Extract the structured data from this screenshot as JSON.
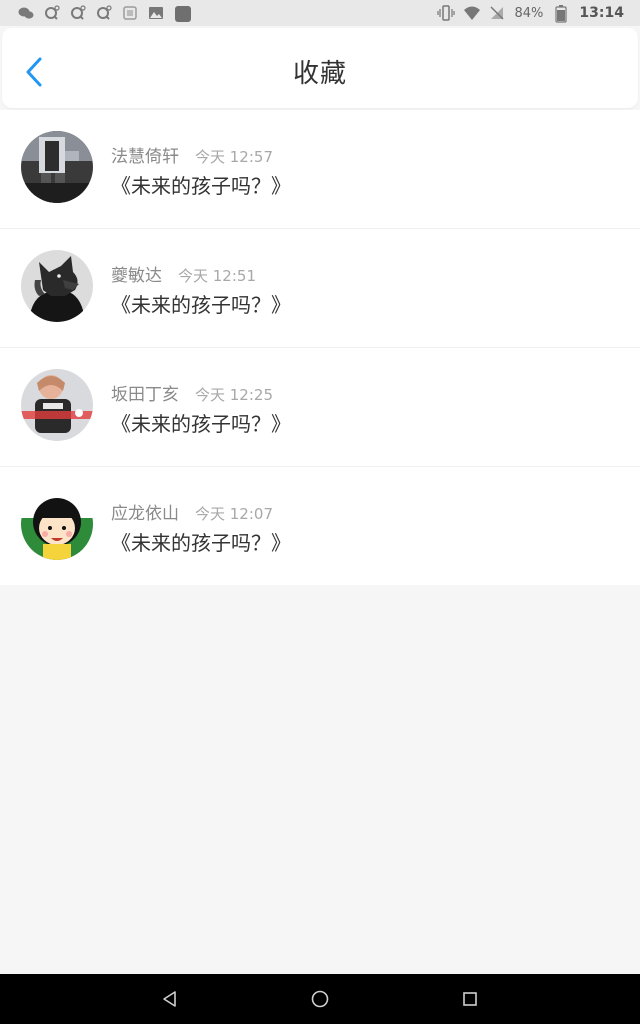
{
  "status_bar": {
    "battery": "84%",
    "time": "13:14"
  },
  "header": {
    "title": "收藏"
  },
  "favorites": [
    {
      "name": "法慧倚轩",
      "time": "今天 12:57",
      "content": "《未来的孩子吗？》"
    },
    {
      "name": "夔敏达",
      "time": "今天 12:51",
      "content": "《未来的孩子吗？》"
    },
    {
      "name": "坂田丁亥",
      "time": "今天 12:25",
      "content": "《未来的孩子吗？》"
    },
    {
      "name": "应龙依山",
      "time": "今天 12:07",
      "content": "《未来的孩子吗？》"
    }
  ],
  "colors": {
    "accent": "#2196f3",
    "background": "#f7f6f7"
  }
}
